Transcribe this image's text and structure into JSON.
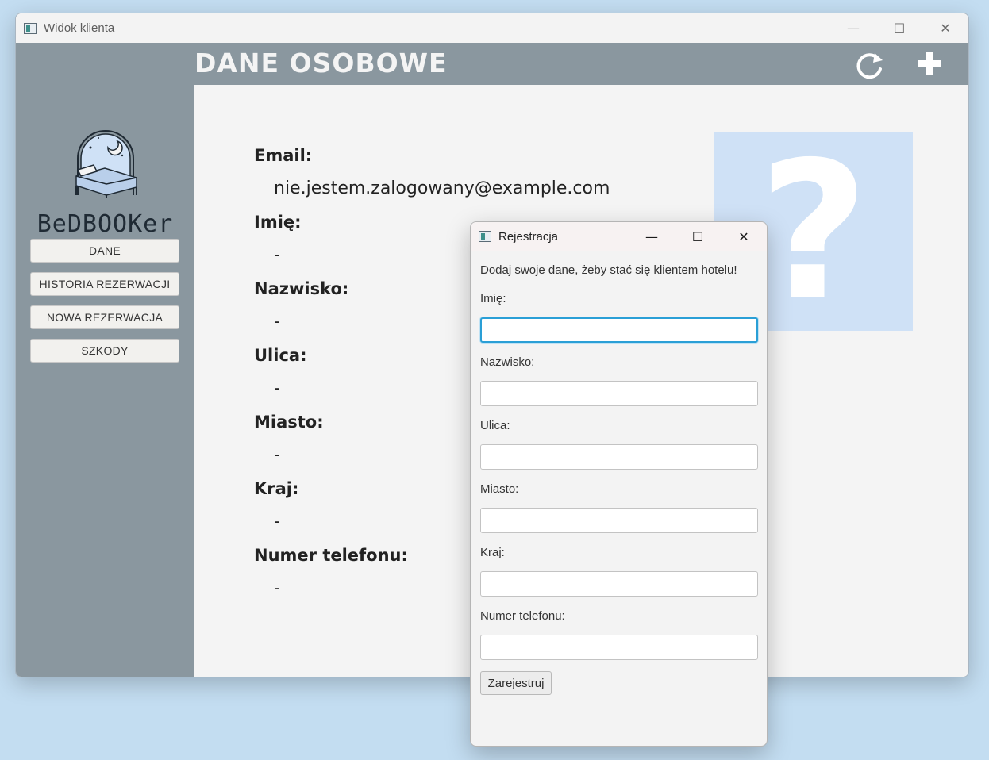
{
  "main_window": {
    "title": "Widok klienta",
    "controls": {
      "minimize": "—",
      "maximize": "☐",
      "close": "✕"
    }
  },
  "header": {
    "title": "DANE OSOBOWE",
    "refresh_icon": "refresh-icon",
    "add_icon": "plus-icon"
  },
  "sidebar": {
    "logo_text": "BeDBOOKer",
    "nav": [
      {
        "label": "DANE"
      },
      {
        "label": "HISTORIA REZERWACJI"
      },
      {
        "label": "NOWA REZERWACJA"
      },
      {
        "label": "SZKODY"
      }
    ]
  },
  "profile": {
    "fields": [
      {
        "label": "Email:",
        "value": "nie.jestem.zalogowany@example.com"
      },
      {
        "label": "Imię:",
        "value": "-"
      },
      {
        "label": "Nazwisko:",
        "value": "-"
      },
      {
        "label": "Ulica:",
        "value": "-"
      },
      {
        "label": "Miasto:",
        "value": "-"
      },
      {
        "label": "Kraj:",
        "value": "-"
      },
      {
        "label": "Numer telefonu:",
        "value": "-"
      }
    ],
    "photo_placeholder": "?"
  },
  "dialog": {
    "title": "Rejestracja",
    "intro": "Dodaj swoje dane, żeby stać się klientem hotelu!",
    "fields": [
      {
        "label": "Imię:",
        "value": ""
      },
      {
        "label": "Nazwisko:",
        "value": ""
      },
      {
        "label": "Ulica:",
        "value": ""
      },
      {
        "label": "Miasto:",
        "value": ""
      },
      {
        "label": "Kraj:",
        "value": ""
      },
      {
        "label": "Numer telefonu:",
        "value": ""
      }
    ],
    "submit_label": "Zarejestruj"
  },
  "colors": {
    "sidebar": "#8a979f",
    "background": "#c3ddf1",
    "placeholder": "#cfe1f6",
    "focus": "#2a9fd6"
  }
}
